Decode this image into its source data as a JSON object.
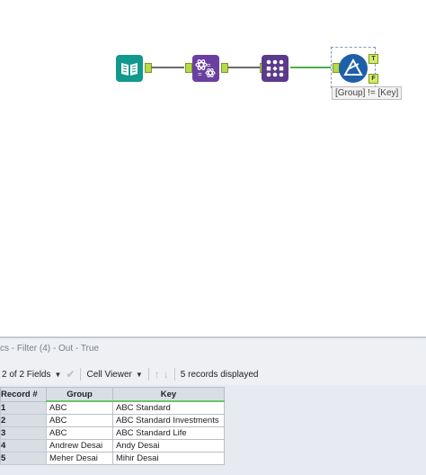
{
  "canvas": {
    "tools": [
      {
        "name": "input-tool",
        "color": "#11998e"
      },
      {
        "name": "formula-tool",
        "color": "#6b3fa0"
      },
      {
        "name": "transpose-tool",
        "color": "#5b3a8c"
      },
      {
        "name": "filter-tool",
        "color": "#1d5fa8"
      }
    ],
    "filter_anchor_true": "T",
    "filter_anchor_false": "F",
    "filter_annotation": "[Group] != [Key]"
  },
  "results": {
    "title": "cs - Filter (4) - Out - True",
    "fields_label": "2 of 2 Fields",
    "cell_viewer_label": "Cell Viewer",
    "records_label": "5 records displayed",
    "columns": [
      "Record #",
      "Group",
      "Key"
    ],
    "rows": [
      {
        "rec": "1",
        "group": "ABC",
        "key": "ABC Standard"
      },
      {
        "rec": "2",
        "group": "ABC",
        "key": "ABC Standard Investments"
      },
      {
        "rec": "3",
        "group": "ABC",
        "key": "ABC Standard Life"
      },
      {
        "rec": "4",
        "group": "Andrew Desai",
        "key": "Andy Desai"
      },
      {
        "rec": "5",
        "group": "Meher Desai",
        "key": "Mihir Desai"
      }
    ]
  }
}
